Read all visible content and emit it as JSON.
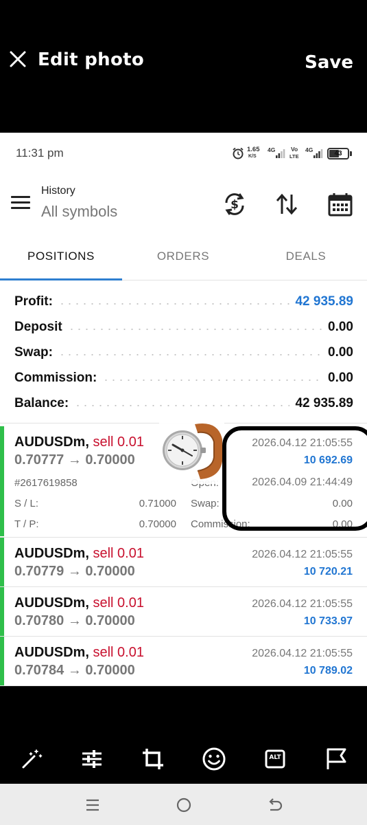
{
  "editor": {
    "title": "Edit photo",
    "save_label": "Save"
  },
  "status_bar": {
    "time": "11:31 pm",
    "speed_value": "1.65",
    "speed_unit": "K/S",
    "network_1": "4G",
    "volte_top": "Vo",
    "volte_bottom": "LTE",
    "network_2": "4G",
    "battery": "43"
  },
  "app_bar": {
    "title": "History",
    "subtitle": "All symbols",
    "actions": [
      "currency-exchange-icon",
      "sort-icon",
      "calendar-icon"
    ]
  },
  "tabs": [
    {
      "label": "POSITIONS",
      "active": true
    },
    {
      "label": "ORDERS",
      "active": false
    },
    {
      "label": "DEALS",
      "active": false
    }
  ],
  "summary": [
    {
      "label": "Profit:",
      "value": "42 935.89",
      "highlight": true
    },
    {
      "label": "Deposit",
      "value": "0.00",
      "highlight": false
    },
    {
      "label": "Swap:",
      "value": "0.00",
      "highlight": false
    },
    {
      "label": "Commission:",
      "value": "0.00",
      "highlight": false
    },
    {
      "label": "Balance:",
      "value": "42 935.89",
      "highlight": false
    }
  ],
  "positions": [
    {
      "symbol": "AUDUSDm,",
      "side": "sell 0.01",
      "prices": "0.70777 → 0.70000",
      "close_time": "2026.04.12 21:05:55",
      "profit": "10 692.69",
      "details": {
        "ticket": "#2617619858",
        "open_label": "Open:",
        "open_time": "2026.04.09 21:44:49",
        "sl_label": "S / L:",
        "sl_value": "0.71000",
        "swap_label": "Swap:",
        "swap_value": "0.00",
        "tp_label": "T / P:",
        "tp_value": "0.70000",
        "commission_label": "Commission:",
        "commission_value": "0.00"
      }
    },
    {
      "symbol": "AUDUSDm,",
      "side": "sell 0.01",
      "prices": "0.70779 → 0.70000",
      "close_time": "2026.04.12 21:05:55",
      "profit": "10 720.21"
    },
    {
      "symbol": "AUDUSDm,",
      "side": "sell 0.01",
      "prices": "0.70780 → 0.70000",
      "close_time": "2026.04.12 21:05:55",
      "profit": "10 733.97"
    },
    {
      "symbol": "AUDUSDm,",
      "side": "sell 0.01",
      "prices": "0.70784 → 0.70000",
      "close_time": "2026.04.12 21:05:55",
      "profit": "10 789.02"
    }
  ],
  "overlays": {
    "sticker": "wristwatch-sticker",
    "annotation": "circle-annotation"
  },
  "tools": [
    "magic-wand-icon",
    "adjust-sliders-icon",
    "crop-icon",
    "emoji-icon",
    "alt-text-icon",
    "flag-icon"
  ],
  "tool_alt_label": "ALT",
  "colors": {
    "profit_blue": "#2176d2",
    "sell_red": "#c8102e",
    "position_bar_green": "#2fbf4a",
    "tab_accent": "#2f7fd0"
  }
}
